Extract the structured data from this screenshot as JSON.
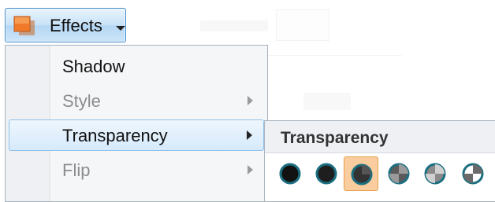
{
  "toolbar": {
    "effects_button": {
      "label": "Effects",
      "icon": "effects-icon",
      "dropdown_icon": "chevron-down-icon"
    }
  },
  "menu": {
    "items": [
      {
        "label": "Shadow",
        "enabled": true,
        "has_submenu": false
      },
      {
        "label": "Style",
        "enabled": false,
        "has_submenu": true
      },
      {
        "label": "Transparency",
        "enabled": true,
        "has_submenu": true,
        "selected": true
      },
      {
        "label": "Flip",
        "enabled": false,
        "has_submenu": true
      }
    ]
  },
  "submenu": {
    "title": "Transparency",
    "swatches": [
      {
        "name": "transparency-0",
        "selected": false
      },
      {
        "name": "transparency-1",
        "selected": false
      },
      {
        "name": "transparency-2",
        "selected": true
      },
      {
        "name": "transparency-3",
        "selected": false
      },
      {
        "name": "transparency-4",
        "selected": false
      },
      {
        "name": "transparency-5",
        "selected": false
      }
    ]
  },
  "colors": {
    "accent_border": "#3f8ccb",
    "selected_swatch": "#f9cd9d",
    "swatch_ring": "#1b6f80"
  }
}
